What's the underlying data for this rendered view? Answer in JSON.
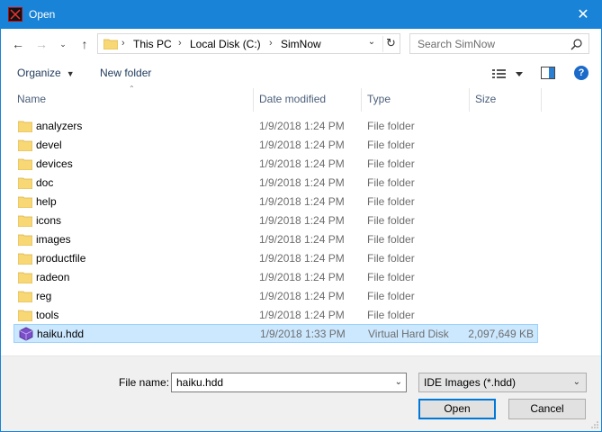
{
  "window": {
    "title": "Open",
    "close_label": "✕"
  },
  "navbar": {
    "breadcrumbs": [
      "This PC",
      "Local Disk (C:)",
      "SimNow"
    ],
    "search_placeholder": "Search SimNow"
  },
  "toolbar": {
    "organize_label": "Organize",
    "new_folder_label": "New folder",
    "help_label": "?"
  },
  "columns": {
    "name": "Name",
    "date": "Date modified",
    "type": "Type",
    "size": "Size"
  },
  "files": [
    {
      "name": "analyzers",
      "date": "1/9/2018 1:24 PM",
      "type": "File folder",
      "size": "",
      "icon": "folder-icon"
    },
    {
      "name": "devel",
      "date": "1/9/2018 1:24 PM",
      "type": "File folder",
      "size": "",
      "icon": "folder-icon"
    },
    {
      "name": "devices",
      "date": "1/9/2018 1:24 PM",
      "type": "File folder",
      "size": "",
      "icon": "folder-icon"
    },
    {
      "name": "doc",
      "date": "1/9/2018 1:24 PM",
      "type": "File folder",
      "size": "",
      "icon": "folder-icon"
    },
    {
      "name": "help",
      "date": "1/9/2018 1:24 PM",
      "type": "File folder",
      "size": "",
      "icon": "folder-icon"
    },
    {
      "name": "icons",
      "date": "1/9/2018 1:24 PM",
      "type": "File folder",
      "size": "",
      "icon": "folder-icon"
    },
    {
      "name": "images",
      "date": "1/9/2018 1:24 PM",
      "type": "File folder",
      "size": "",
      "icon": "folder-icon"
    },
    {
      "name": "productfile",
      "date": "1/9/2018 1:24 PM",
      "type": "File folder",
      "size": "",
      "icon": "folder-icon"
    },
    {
      "name": "radeon",
      "date": "1/9/2018 1:24 PM",
      "type": "File folder",
      "size": "",
      "icon": "folder-icon"
    },
    {
      "name": "reg",
      "date": "1/9/2018 1:24 PM",
      "type": "File folder",
      "size": "",
      "icon": "folder-icon"
    },
    {
      "name": "tools",
      "date": "1/9/2018 1:24 PM",
      "type": "File folder",
      "size": "",
      "icon": "folder-icon"
    },
    {
      "name": "haiku.hdd",
      "date": "1/9/2018 1:33 PM",
      "type": "Virtual Hard Disk",
      "size": "2,097,649 KB",
      "icon": "virtual-disk-icon",
      "selected": true
    }
  ],
  "bottom": {
    "file_name_label": "File name:",
    "file_name_value": "haiku.hdd",
    "filter_value": "IDE Images (*.hdd)",
    "open_label": "Open",
    "cancel_label": "Cancel"
  },
  "colors": {
    "titlebar": "#1883d7",
    "selection": "#cce8ff",
    "folder": "#f8d775"
  }
}
